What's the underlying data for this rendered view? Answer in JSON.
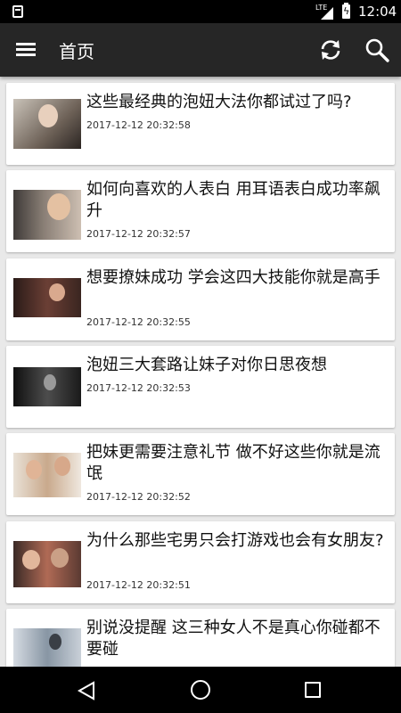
{
  "status_bar": {
    "network_label": "LTE",
    "time": "12:04"
  },
  "app_bar": {
    "title": "首页",
    "icons": [
      "menu-icon",
      "refresh-icon",
      "search-icon"
    ]
  },
  "articles": [
    {
      "title": "这些最经典的泡妞大法你都试过了吗?",
      "time": "2017-12-12 20:32:58"
    },
    {
      "title": "如何向喜欢的人表白 用耳语表白成功率飙升",
      "time": "2017-12-12 20:32:57"
    },
    {
      "title": "想要撩妹成功 学会这四大技能你就是高手",
      "time": "2017-12-12 20:32:55"
    },
    {
      "title": "泡妞三大套路让妹子对你日思夜想",
      "time": "2017-12-12 20:32:53"
    },
    {
      "title": "把妹更需要注意礼节 做不好这些你就是流氓",
      "time": "2017-12-12 20:32:52"
    },
    {
      "title": "为什么那些宅男只会打游戏也会有女朋友?",
      "time": "2017-12-12 20:32:51"
    },
    {
      "title": "别说没提醒 这三种女人不是真心你碰都不要碰",
      "time": ""
    }
  ],
  "nav_bar": {
    "icons": [
      "back-icon",
      "home-icon",
      "recents-icon"
    ]
  }
}
